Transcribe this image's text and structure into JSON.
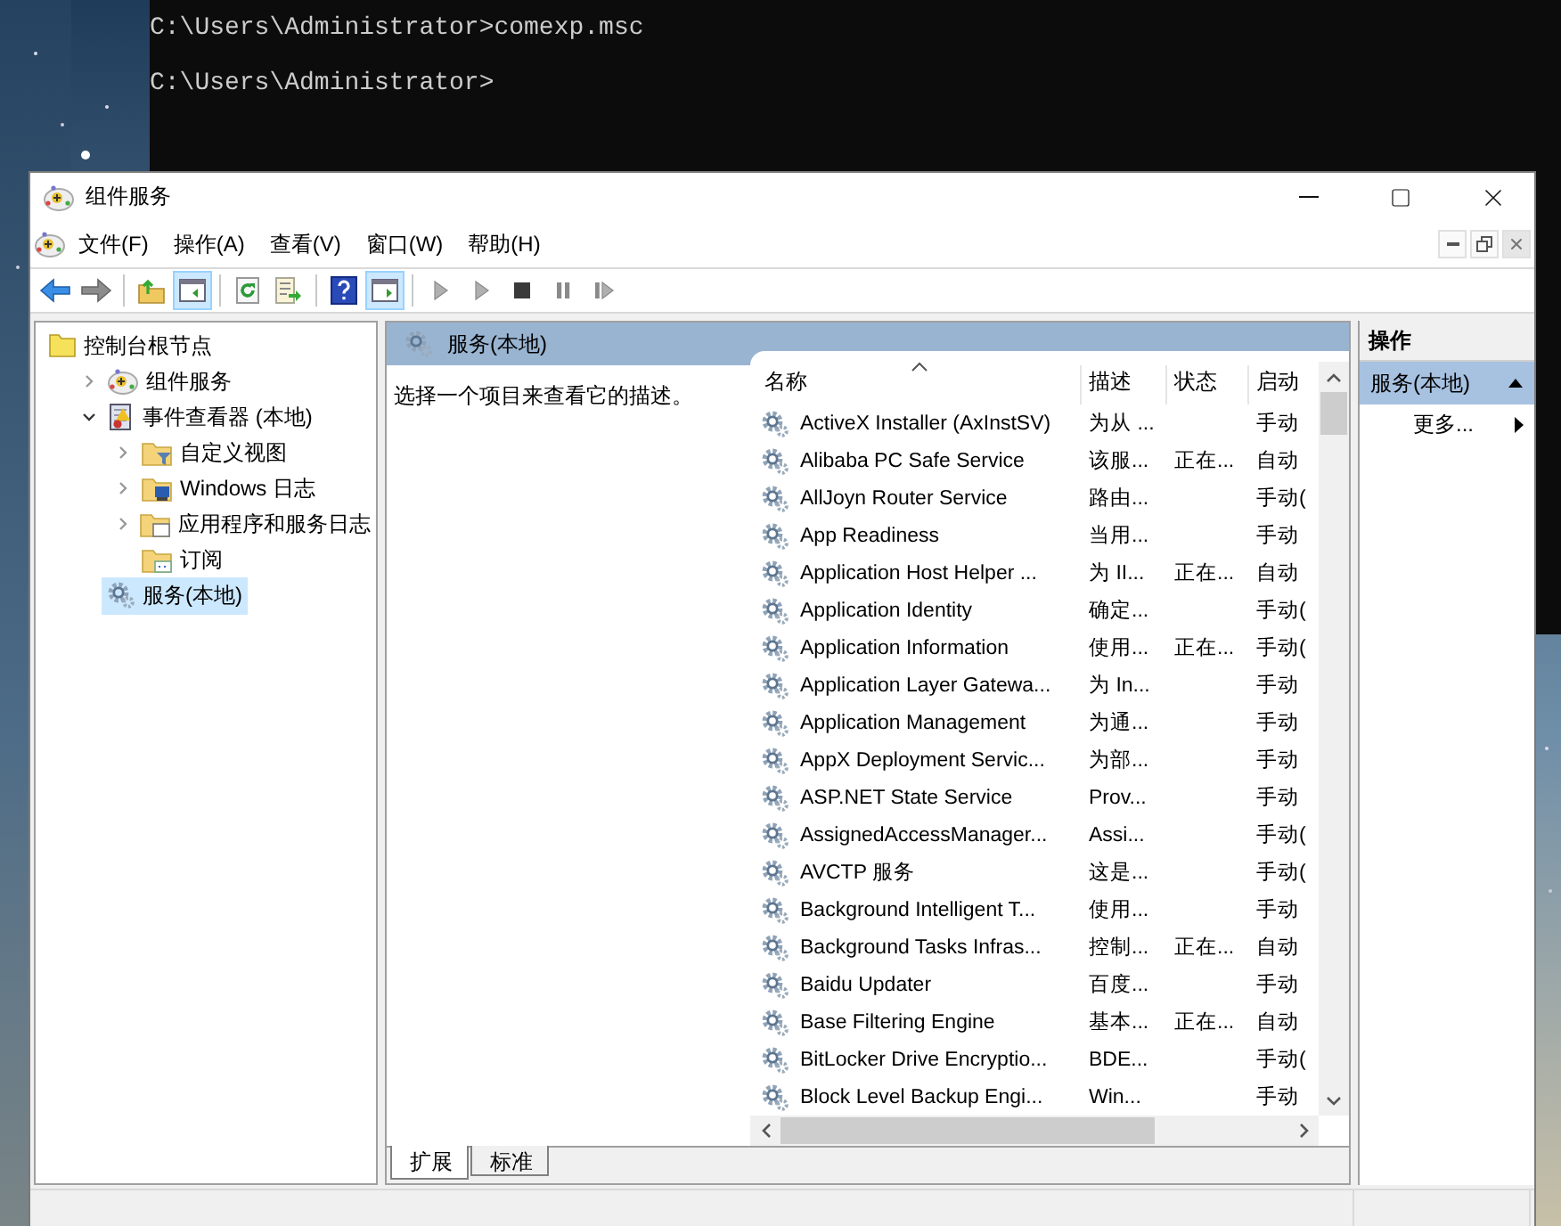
{
  "console": {
    "lines": [
      "C:\\Users\\Administrator>comexp.msc",
      "C:\\Users\\Administrator>"
    ]
  },
  "window": {
    "title": "组件服务"
  },
  "menu": [
    "文件(F)",
    "操作(A)",
    "查看(V)",
    "窗口(W)",
    "帮助(H)"
  ],
  "toolbar": [
    {
      "kind": "back",
      "pressed": false
    },
    {
      "kind": "forward",
      "pressed": false
    },
    {
      "kind": "separator"
    },
    {
      "kind": "up-folder",
      "pressed": false
    },
    {
      "kind": "console-tree",
      "pressed": true
    },
    {
      "kind": "separator"
    },
    {
      "kind": "refresh",
      "pressed": false
    },
    {
      "kind": "export",
      "pressed": false
    },
    {
      "kind": "separator"
    },
    {
      "kind": "help",
      "pressed": false
    },
    {
      "kind": "action-pane",
      "pressed": true
    },
    {
      "kind": "separator"
    },
    {
      "kind": "play",
      "pressed": false
    },
    {
      "kind": "play",
      "pressed": false
    },
    {
      "kind": "stop",
      "pressed": false
    },
    {
      "kind": "pause",
      "pressed": false
    },
    {
      "kind": "resume",
      "pressed": false
    }
  ],
  "tree": [
    {
      "label": "控制台根节点",
      "kind": "root-folder",
      "selected": false,
      "children": [
        {
          "label": "组件服务",
          "kind": "component",
          "selected": false,
          "expanded": false
        },
        {
          "label": "事件查看器 (本地)",
          "kind": "event-viewer",
          "selected": false,
          "expanded": true,
          "children": [
            {
              "label": "自定义视图",
              "kind": "folder-filter",
              "selected": false,
              "expanded": false
            },
            {
              "label": "Windows 日志",
              "kind": "folder-log",
              "selected": false,
              "expanded": false
            },
            {
              "label": "应用程序和服务日志",
              "kind": "folder-app",
              "selected": false,
              "expanded": false
            },
            {
              "label": "订阅",
              "kind": "folder-subscription",
              "selected": false
            }
          ]
        },
        {
          "label": "服务(本地)",
          "kind": "services",
          "selected": true
        }
      ]
    }
  ],
  "services_panel": {
    "title": "服务(本地)",
    "description": "选择一个项目来查看它的描述。",
    "columns": [
      {
        "label": "名称",
        "sorted": true
      },
      {
        "label": "描述",
        "sorted": false
      },
      {
        "label": "状态",
        "sorted": false
      },
      {
        "label": "启动",
        "sorted": false
      }
    ],
    "rows": [
      {
        "name": "ActiveX Installer (AxInstSV)",
        "description": "为从 ...",
        "startup": "手动"
      },
      {
        "name": "Alibaba PC Safe Service",
        "description": "该服...",
        "status": "正在...",
        "startup": "自动"
      },
      {
        "name": "AllJoyn Router Service",
        "description": "路由...",
        "startup": "手动("
      },
      {
        "name": "App Readiness",
        "description": "当用...",
        "startup": "手动"
      },
      {
        "name": "Application Host Helper ...",
        "description": "为 II...",
        "status": "正在...",
        "startup": "自动"
      },
      {
        "name": "Application Identity",
        "description": "确定...",
        "startup": "手动("
      },
      {
        "name": "Application Information",
        "description": "使用...",
        "status": "正在...",
        "startup": "手动("
      },
      {
        "name": "Application Layer Gatewa...",
        "description": "为 In...",
        "startup": "手动"
      },
      {
        "name": "Application Management",
        "description": "为通...",
        "startup": "手动"
      },
      {
        "name": "AppX Deployment Servic...",
        "description": "为部...",
        "startup": "手动"
      },
      {
        "name": "ASP.NET State Service",
        "description": "Prov...",
        "startup": "手动"
      },
      {
        "name": "AssignedAccessManager...",
        "description": "Assi...",
        "startup": "手动("
      },
      {
        "name": "AVCTP 服务",
        "description": "这是...",
        "startup": "手动("
      },
      {
        "name": "Background Intelligent T...",
        "description": "使用...",
        "startup": "手动"
      },
      {
        "name": "Background Tasks Infras...",
        "description": "控制...",
        "status": "正在...",
        "startup": "自动"
      },
      {
        "name": "Baidu Updater",
        "description": "百度...",
        "startup": "手动"
      },
      {
        "name": "Base Filtering Engine",
        "description": "基本...",
        "status": "正在...",
        "startup": "自动"
      },
      {
        "name": "BitLocker Drive Encryptio...",
        "description": "BDE...",
        "startup": "手动("
      },
      {
        "name": "Block Level Backup Engi...",
        "description": "Win...",
        "startup": "手动"
      }
    ]
  },
  "bottom_tabs": [
    {
      "label": "扩展",
      "selected": true
    },
    {
      "label": "标准",
      "selected": false
    }
  ],
  "actions": {
    "title": "操作",
    "sections": [
      {
        "label": "服务(本地)",
        "expanded": true,
        "items": [
          "更多..."
        ]
      }
    ]
  }
}
